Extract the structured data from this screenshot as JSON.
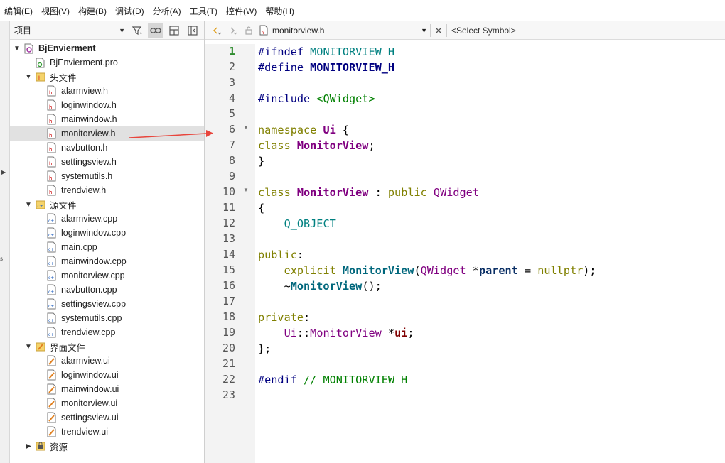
{
  "menubar": [
    "编辑(E)",
    "视图(V)",
    "构建(B)",
    "调试(D)",
    "分析(A)",
    "工具(T)",
    "控件(W)",
    "帮助(H)"
  ],
  "project_pane": {
    "selector_label": "项目",
    "tree": [
      {
        "label": "BjEnvierment",
        "level": 0,
        "toggle": "▼",
        "icon": "project-icon",
        "bold": true
      },
      {
        "label": "BjEnvierment.pro",
        "level": 1,
        "toggle": "",
        "icon": "pro-file-icon"
      },
      {
        "label": "头文件",
        "level": 1,
        "toggle": "▼",
        "icon": "folder-header-icon"
      },
      {
        "label": "alarmview.h",
        "level": 2,
        "toggle": "",
        "icon": "header-file-icon"
      },
      {
        "label": "loginwindow.h",
        "level": 2,
        "toggle": "",
        "icon": "header-file-icon"
      },
      {
        "label": "mainwindow.h",
        "level": 2,
        "toggle": "",
        "icon": "header-file-icon"
      },
      {
        "label": "monitorview.h",
        "level": 2,
        "toggle": "",
        "icon": "header-file-icon",
        "selected": true
      },
      {
        "label": "navbutton.h",
        "level": 2,
        "toggle": "",
        "icon": "header-file-icon"
      },
      {
        "label": "settingsview.h",
        "level": 2,
        "toggle": "",
        "icon": "header-file-icon"
      },
      {
        "label": "systemutils.h",
        "level": 2,
        "toggle": "",
        "icon": "header-file-icon"
      },
      {
        "label": "trendview.h",
        "level": 2,
        "toggle": "",
        "icon": "header-file-icon"
      },
      {
        "label": "源文件",
        "level": 1,
        "toggle": "▼",
        "icon": "folder-source-icon"
      },
      {
        "label": "alarmview.cpp",
        "level": 2,
        "toggle": "",
        "icon": "cpp-file-icon"
      },
      {
        "label": "loginwindow.cpp",
        "level": 2,
        "toggle": "",
        "icon": "cpp-file-icon"
      },
      {
        "label": "main.cpp",
        "level": 2,
        "toggle": "",
        "icon": "cpp-file-icon"
      },
      {
        "label": "mainwindow.cpp",
        "level": 2,
        "toggle": "",
        "icon": "cpp-file-icon"
      },
      {
        "label": "monitorview.cpp",
        "level": 2,
        "toggle": "",
        "icon": "cpp-file-icon"
      },
      {
        "label": "navbutton.cpp",
        "level": 2,
        "toggle": "",
        "icon": "cpp-file-icon"
      },
      {
        "label": "settingsview.cpp",
        "level": 2,
        "toggle": "",
        "icon": "cpp-file-icon"
      },
      {
        "label": "systemutils.cpp",
        "level": 2,
        "toggle": "",
        "icon": "cpp-file-icon"
      },
      {
        "label": "trendview.cpp",
        "level": 2,
        "toggle": "",
        "icon": "cpp-file-icon"
      },
      {
        "label": "界面文件",
        "level": 1,
        "toggle": "▼",
        "icon": "folder-forms-icon"
      },
      {
        "label": "alarmview.ui",
        "level": 2,
        "toggle": "",
        "icon": "ui-file-icon"
      },
      {
        "label": "loginwindow.ui",
        "level": 2,
        "toggle": "",
        "icon": "ui-file-icon"
      },
      {
        "label": "mainwindow.ui",
        "level": 2,
        "toggle": "",
        "icon": "ui-file-icon"
      },
      {
        "label": "monitorview.ui",
        "level": 2,
        "toggle": "",
        "icon": "ui-file-icon"
      },
      {
        "label": "settingsview.ui",
        "level": 2,
        "toggle": "",
        "icon": "ui-file-icon"
      },
      {
        "label": "trendview.ui",
        "level": 2,
        "toggle": "",
        "icon": "ui-file-icon"
      },
      {
        "label": "资源",
        "level": 1,
        "toggle": "▶",
        "icon": "folder-resources-icon"
      }
    ]
  },
  "editor": {
    "file_name": "monitorview.h",
    "symbol_placeholder": "<Select Symbol>",
    "current_line": 1,
    "line_count": 23,
    "fold_lines": [
      6,
      10
    ],
    "code": [
      [
        [
          "pp",
          "#ifndef "
        ],
        [
          "macname",
          "MONITORVIEW_H"
        ]
      ],
      [
        [
          "pp",
          "#define "
        ],
        [
          "macdef",
          "MONITORVIEW_H"
        ]
      ],
      [],
      [
        [
          "pp",
          "#include "
        ],
        [
          "inc",
          "<QWidget>"
        ]
      ],
      [],
      [
        [
          "kw",
          "namespace "
        ],
        [
          "ty-b",
          "Ui"
        ],
        [
          "plain",
          " {"
        ]
      ],
      [
        [
          "kw",
          "class "
        ],
        [
          "ty-b",
          "MonitorView"
        ],
        [
          "plain",
          ";"
        ]
      ],
      [
        [
          "plain",
          "}"
        ]
      ],
      [],
      [
        [
          "kw",
          "class "
        ],
        [
          "ty-b",
          "MonitorView"
        ],
        [
          "plain",
          " : "
        ],
        [
          "kw",
          "public "
        ],
        [
          "ty",
          "QWidget"
        ]
      ],
      [
        [
          "plain",
          "{"
        ]
      ],
      [
        [
          "plain",
          "    "
        ],
        [
          "macro",
          "Q_OBJECT"
        ]
      ],
      [],
      [
        [
          "kw",
          "public"
        ],
        [
          "plain",
          ":"
        ]
      ],
      [
        [
          "plain",
          "    "
        ],
        [
          "kw",
          "explicit "
        ],
        [
          "fn",
          "MonitorView"
        ],
        [
          "plain",
          "("
        ],
        [
          "ty",
          "QWidget"
        ],
        [
          "plain",
          " *"
        ],
        [
          "param",
          "parent"
        ],
        [
          "plain",
          " = "
        ],
        [
          "kw",
          "nullptr"
        ],
        [
          "plain",
          ");"
        ]
      ],
      [
        [
          "plain",
          "    ~"
        ],
        [
          "fn",
          "MonitorView"
        ],
        [
          "plain",
          "();"
        ]
      ],
      [],
      [
        [
          "kw",
          "private"
        ],
        [
          "plain",
          ":"
        ]
      ],
      [
        [
          "plain",
          "    "
        ],
        [
          "ns",
          "Ui"
        ],
        [
          "plain",
          "::"
        ],
        [
          "ty",
          "MonitorView"
        ],
        [
          "plain",
          " *"
        ],
        [
          "member",
          "ui"
        ],
        [
          "plain",
          ";"
        ]
      ],
      [
        [
          "plain",
          "};"
        ]
      ],
      [],
      [
        [
          "pp",
          "#endif "
        ],
        [
          "cmt",
          "// MONITORVIEW_H"
        ]
      ],
      []
    ]
  },
  "colors": {
    "arrow": "#e8453c",
    "selection": "#e1e1e1",
    "gutter_bg": "#f3f3f3"
  }
}
